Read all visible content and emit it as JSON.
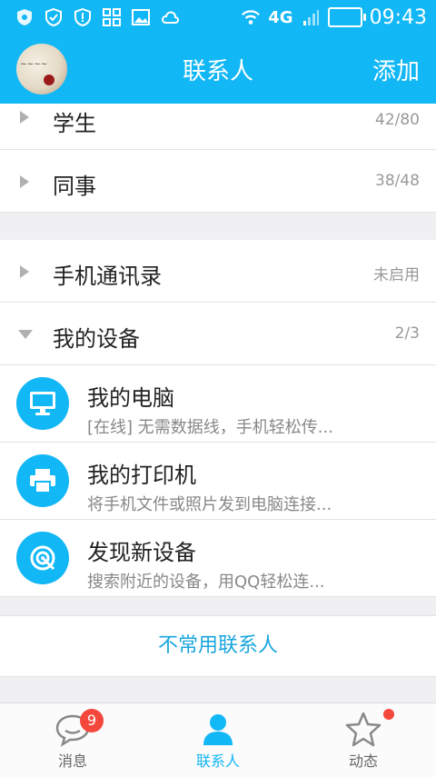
{
  "status_bar": {
    "network": "4G",
    "time": "09:43"
  },
  "app_bar": {
    "title": "联系人",
    "add": "添加"
  },
  "groups": [
    {
      "label": "学生",
      "count": "42/80"
    },
    {
      "label": "同事",
      "count": "38/48"
    }
  ],
  "sections": [
    {
      "label": "手机通讯录",
      "status": "未启用"
    },
    {
      "label": "我的设备",
      "count": "2/3"
    }
  ],
  "devices": [
    {
      "name": "我的电脑",
      "desc": "[在线] 无需数据线，手机轻松传...",
      "icon": "monitor-icon"
    },
    {
      "name": "我的打印机",
      "desc": "将手机文件或照片发到电脑连接...",
      "icon": "printer-icon"
    },
    {
      "name": "发现新设备",
      "desc": "搜索附近的设备，用QQ轻松连...",
      "icon": "radar-icon"
    }
  ],
  "uncommon_contacts": "不常用联系人",
  "tabs": [
    {
      "label": "消息",
      "badge": "9",
      "icon": "chat-bubble-icon"
    },
    {
      "label": "联系人",
      "icon": "person-icon"
    },
    {
      "label": "动态",
      "icon": "star-icon"
    }
  ],
  "colors": {
    "primary": "#12b7f5",
    "badge": "#f5483c",
    "link": "#1aa6dd"
  }
}
